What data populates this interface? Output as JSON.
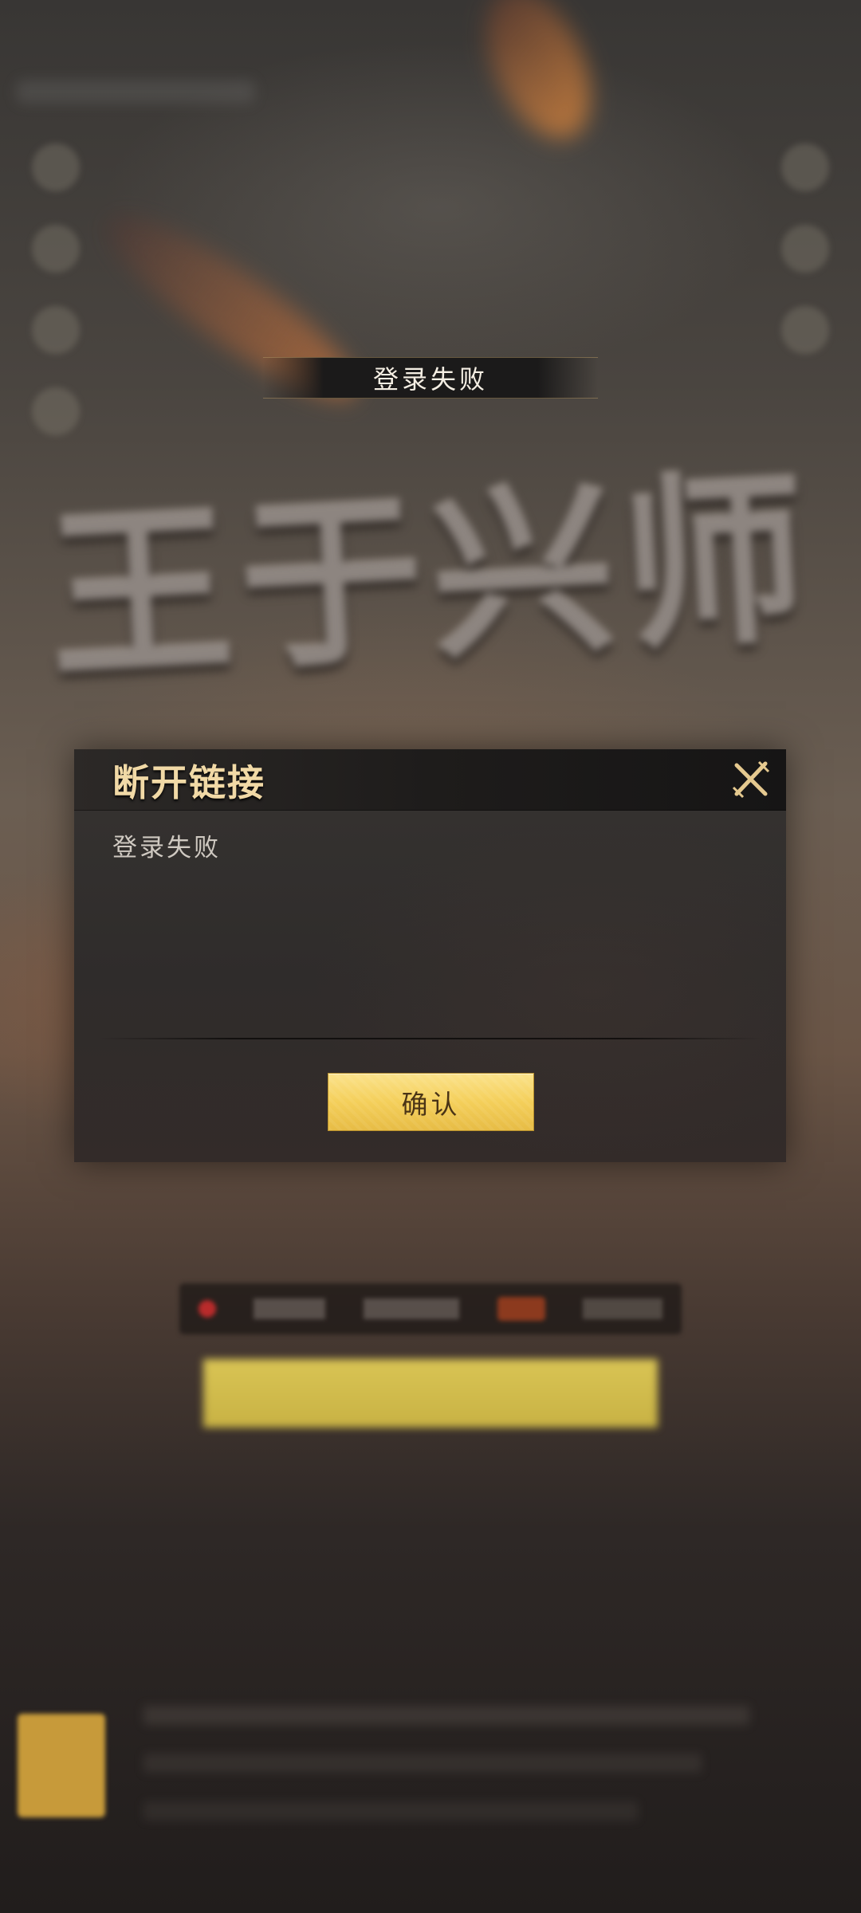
{
  "background": {
    "status_banner": "登录失败",
    "game_logo": "王于兴师"
  },
  "dialog": {
    "title": "断开链接",
    "message": "登录失败",
    "confirm_label": "确认",
    "close_icon": "close-x-icon"
  },
  "colors": {
    "dialog_title": "#f1d9a6",
    "confirm_button": "#f4cf5a",
    "confirm_text": "#4a3416"
  }
}
